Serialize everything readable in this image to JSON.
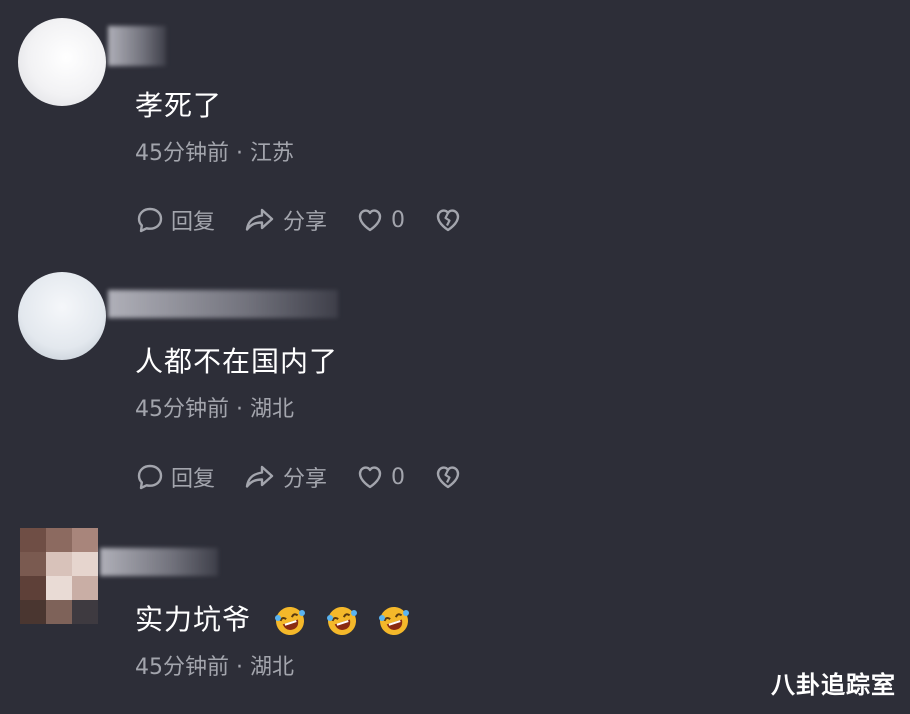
{
  "comments": [
    {
      "text": "孝死了",
      "meta": "45分钟前 · 江苏",
      "reply_label": "回复",
      "share_label": "分享",
      "like_count": "0"
    },
    {
      "text": "人都不在国内了",
      "meta": "45分钟前 · 湖北",
      "reply_label": "回复",
      "share_label": "分享",
      "like_count": "0"
    },
    {
      "text": "实力坑爷",
      "emojis": [
        "laugh-cry-emoji",
        "laugh-cry-emoji",
        "laugh-cry-emoji"
      ],
      "meta": "45分钟前 · 湖北"
    }
  ],
  "watermark": "八卦追踪室",
  "colors": {
    "background": "#2d2e38",
    "text": "#ffffff",
    "meta": "#a3a5ad",
    "emoji": "#f4b82a"
  }
}
